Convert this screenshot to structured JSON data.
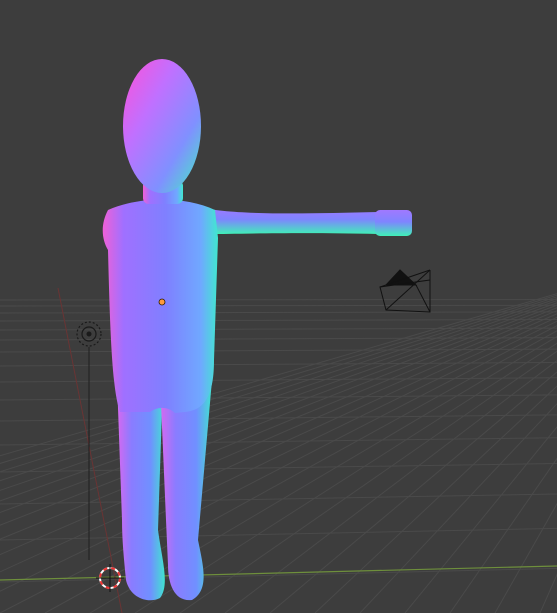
{
  "app": {
    "name": "",
    "view": "3D Viewport"
  },
  "viewport": {
    "background_color": "#3d3d3d",
    "grid_line_color": "#4a4a4a",
    "x_axis_color": "#7a2f2f",
    "y_axis_color": "#6e8f3c",
    "shading": "normal-map",
    "objects": [
      {
        "name": "humanoid-mesh",
        "type": "mesh"
      },
      {
        "name": "camera",
        "type": "camera"
      },
      {
        "name": "light",
        "type": "light"
      },
      {
        "name": "3d-cursor",
        "type": "cursor"
      }
    ]
  }
}
